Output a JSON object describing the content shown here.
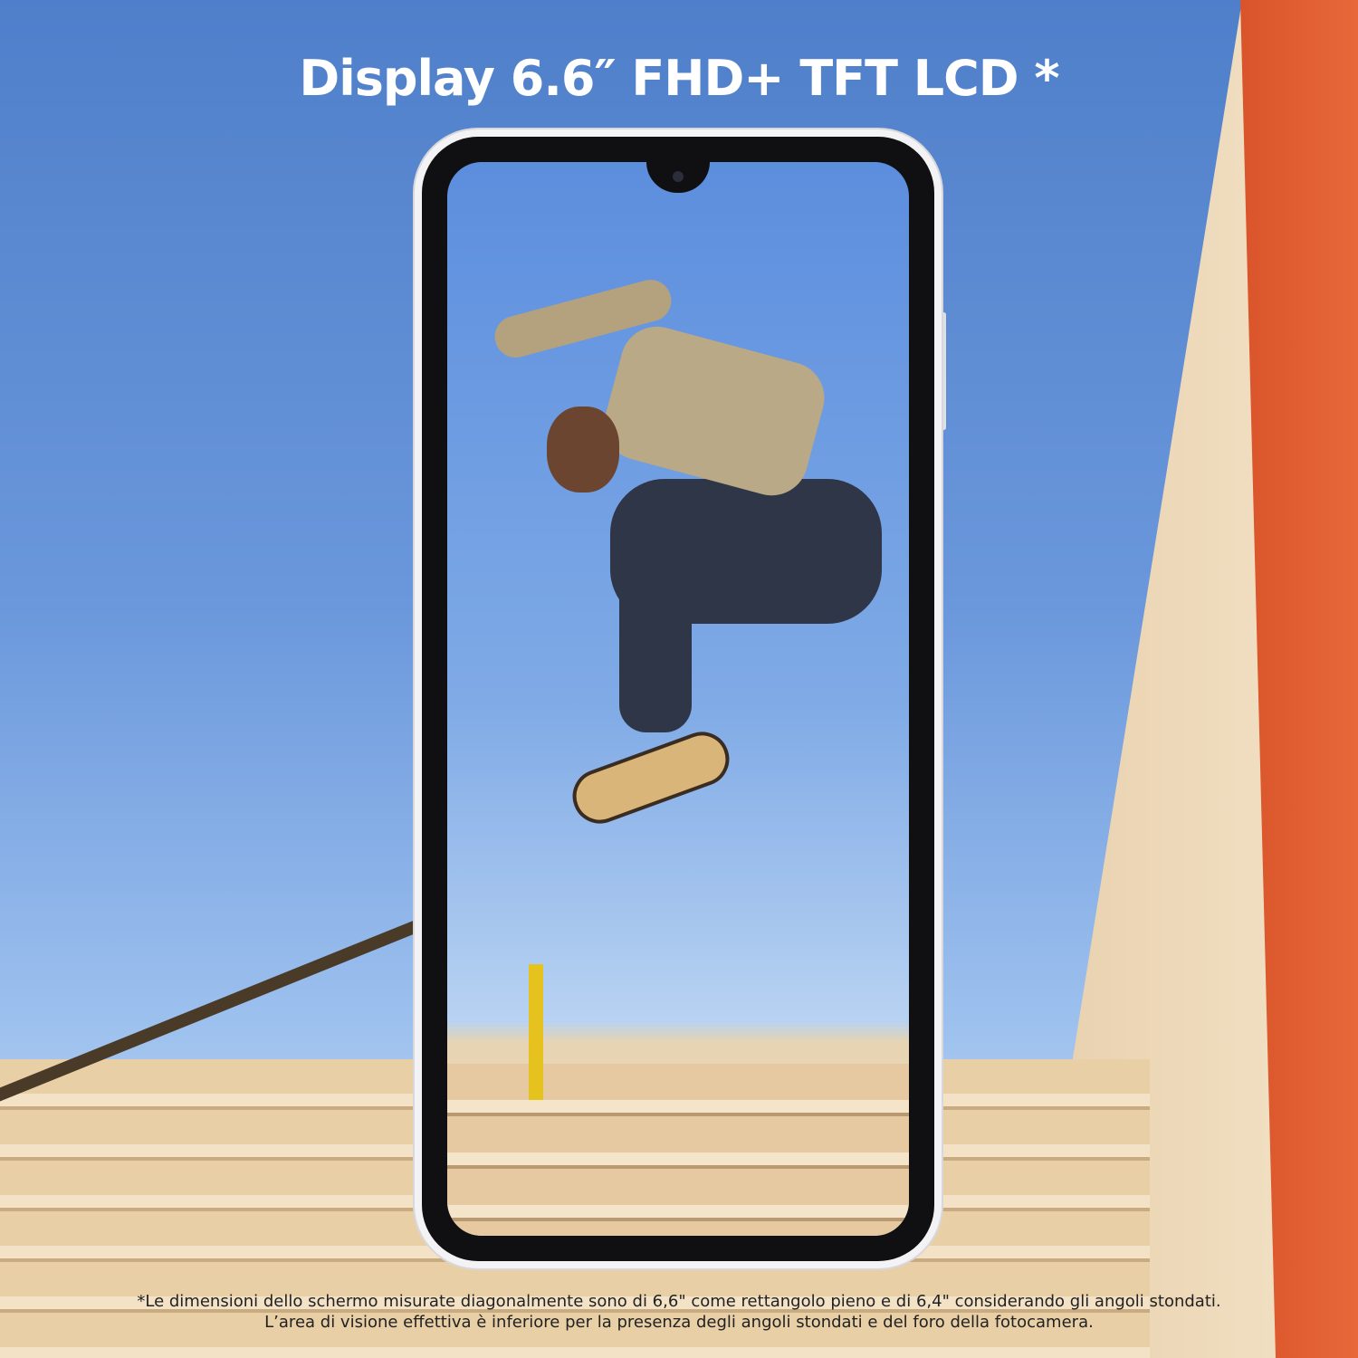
{
  "title": "Display 6.6″ FHD+ TFT LCD *",
  "footnote": {
    "line1": "*Le dimensioni dello schermo misurate diagonalmente sono di 6,6\" come rettangolo pieno e di 6,4\" considerando gli angoli stondati.",
    "line2": "L’area di visione effettiva è inferiore per la presenza degli angoli stondati e del foro della fotocamera."
  }
}
